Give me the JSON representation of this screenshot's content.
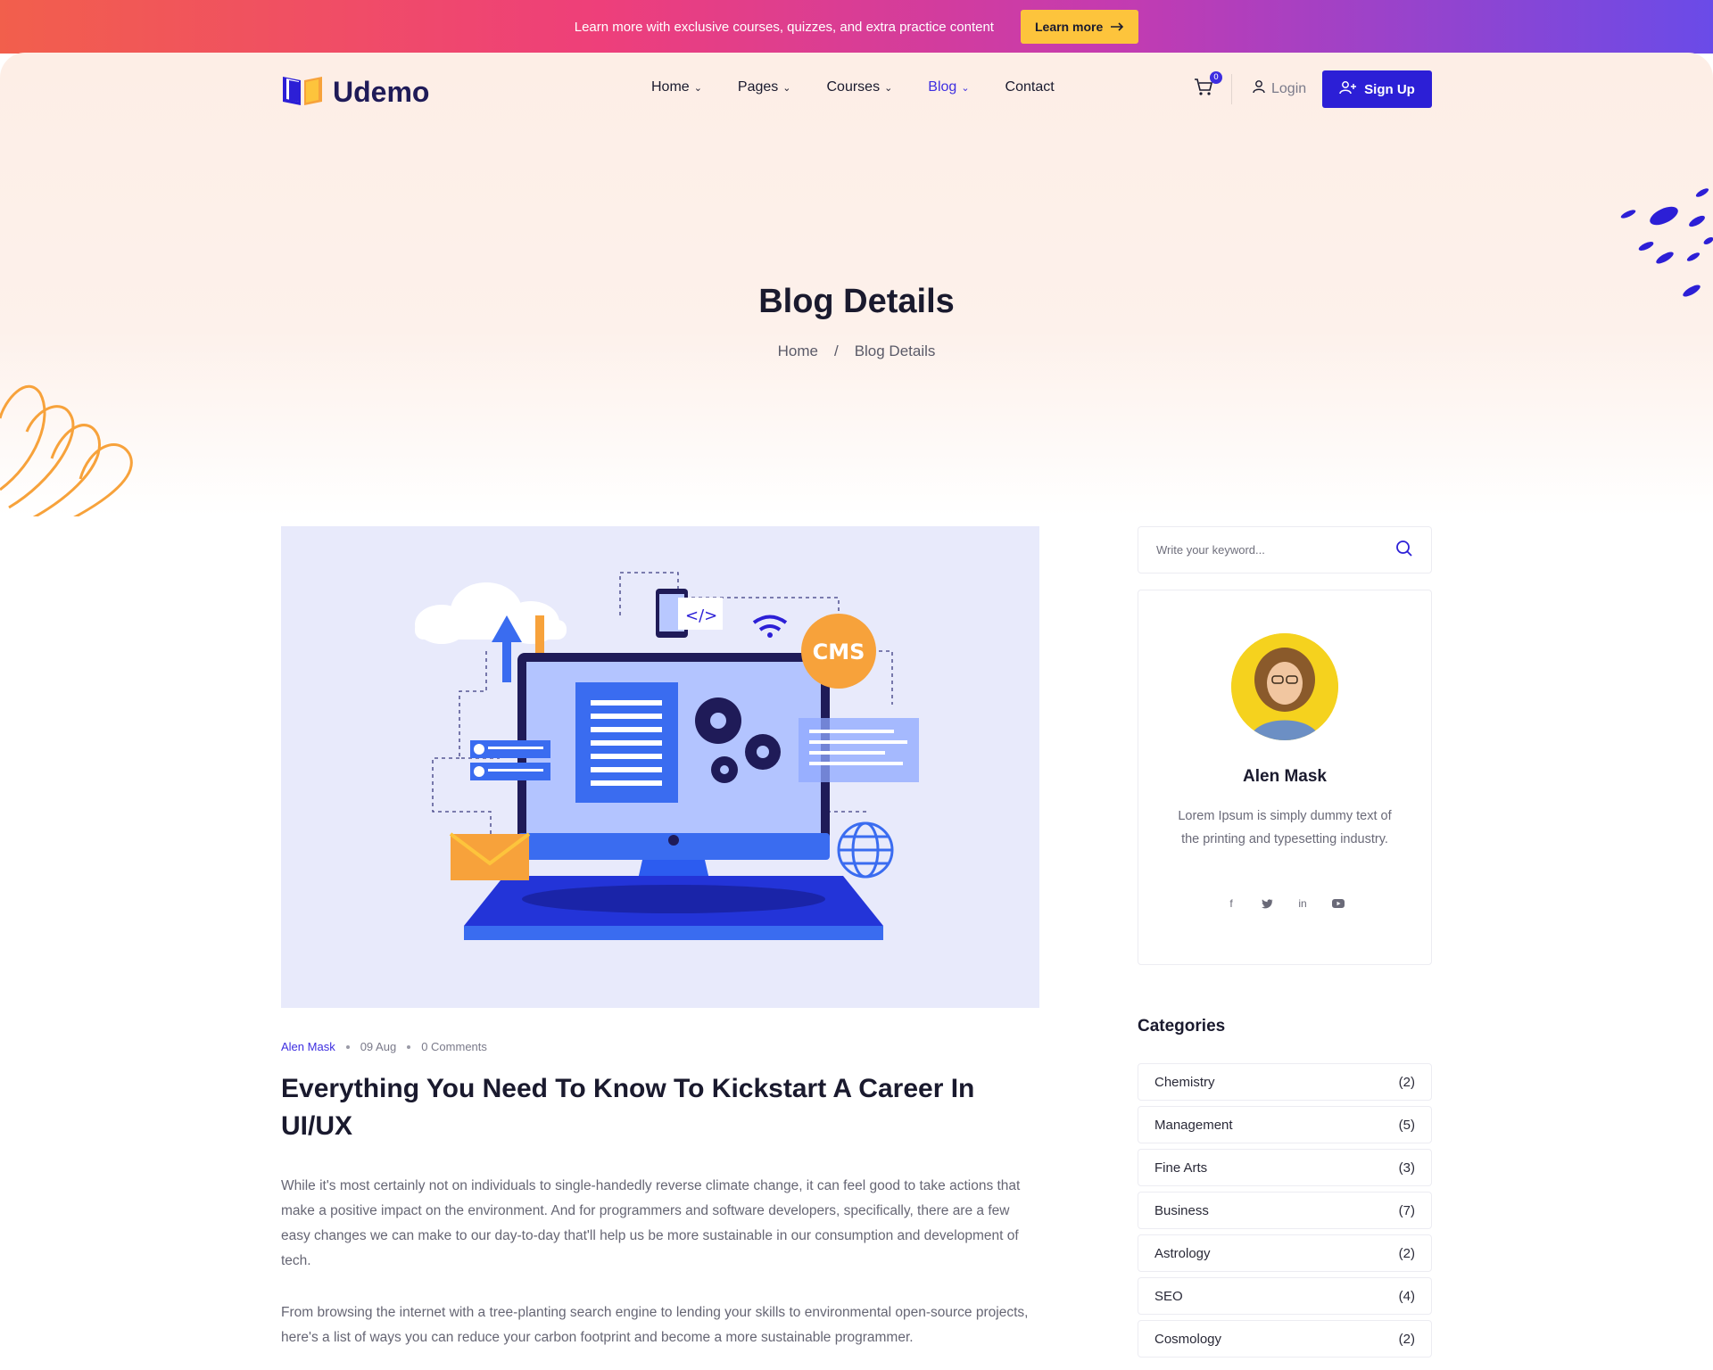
{
  "promo": {
    "text": "Learn more with exclusive courses, quizzes, and extra practice content",
    "button_label": "Learn more"
  },
  "header": {
    "logo_text": "Udemo",
    "nav": [
      {
        "label": "Home",
        "has_dropdown": true
      },
      {
        "label": "Pages",
        "has_dropdown": true
      },
      {
        "label": "Courses",
        "has_dropdown": true
      },
      {
        "label": "Blog",
        "has_dropdown": true,
        "active": true
      },
      {
        "label": "Contact",
        "has_dropdown": false
      }
    ],
    "cart_count": "0",
    "login_label": "Login",
    "signup_label": "Sign Up"
  },
  "hero": {
    "title": "Blog Details",
    "breadcrumb": [
      "Home",
      "/",
      "Blog Details"
    ]
  },
  "post": {
    "author": "Alen Mask",
    "date": "09 Aug",
    "comments": "0 Comments",
    "title": "Everything You Need To Know To Kickstart A Career In UI/UX",
    "paragraphs": [
      "While it's most certainly not on individuals to single-handedly reverse climate change, it can feel good to take actions that make a positive impact on the environment. And for programmers and software developers, specifically, there are a few easy changes we can make to our day-to-day that'll help us be more sustainable in our consumption and development of tech.",
      "From browsing the internet with a tree-planting search engine to lending your skills to environmental open-source projects, here's a list of ways you can reduce your carbon footprint and become a more sustainable programmer."
    ],
    "image_text": "CMS"
  },
  "sidebar": {
    "search_placeholder": "Write your keyword...",
    "author_card": {
      "name": "Alen Mask",
      "bio": "Lorem Ipsum is simply dummy text of the printing and typesetting industry.",
      "socials": [
        "facebook-icon",
        "twitter-icon",
        "linkedin-icon",
        "youtube-icon"
      ]
    },
    "categories_title": "Categories",
    "categories": [
      {
        "name": "Chemistry",
        "count": "(2)"
      },
      {
        "name": "Management",
        "count": "(5)"
      },
      {
        "name": "Fine Arts",
        "count": "(3)"
      },
      {
        "name": "Business",
        "count": "(7)"
      },
      {
        "name": "Astrology",
        "count": "(2)"
      },
      {
        "name": "SEO",
        "count": "(4)"
      },
      {
        "name": "Cosmology",
        "count": "(2)"
      }
    ]
  },
  "colors": {
    "brand": "#2c1fd6",
    "accent_yellow": "#fdc43c",
    "accent_orange": "#f7a23b"
  }
}
